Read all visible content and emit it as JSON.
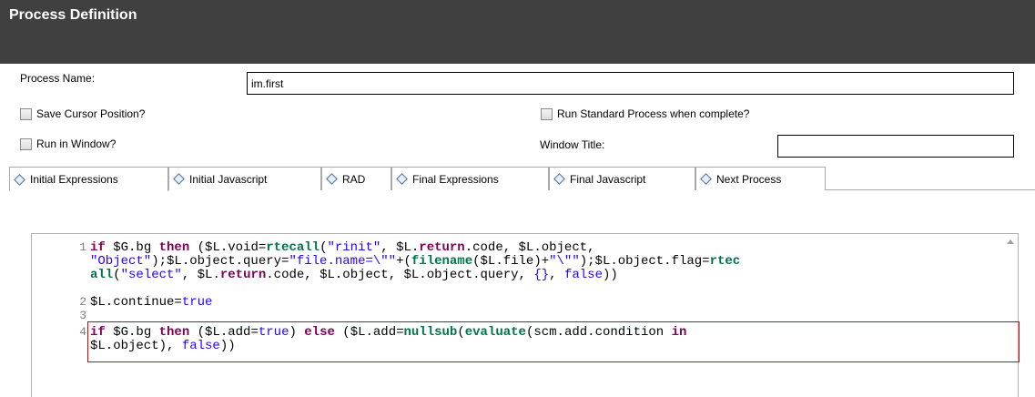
{
  "header": {
    "title": "Process Definition"
  },
  "form": {
    "process_name_label": "Process Name:",
    "process_name_value": "im.first",
    "save_cursor_label": "Save Cursor Position?",
    "run_standard_label": "Run Standard Process when complete?",
    "run_in_window_label": "Run in Window?",
    "window_title_label": "Window Title:",
    "window_title_value": ""
  },
  "tabs": [
    {
      "label": "Initial Expressions",
      "active": true
    },
    {
      "label": "Initial Javascript"
    },
    {
      "label": "RAD"
    },
    {
      "label": "Final Expressions"
    },
    {
      "label": "Final Javascript"
    },
    {
      "label": "Next Process"
    }
  ],
  "editor": {
    "line_numbers": [
      "1",
      "2",
      "3",
      "4"
    ],
    "lines": [
      [
        {
          "t": "if",
          "c": "kw"
        },
        {
          "t": " $G.bg "
        },
        {
          "t": "then",
          "c": "kw"
        },
        {
          "t": " ($L.void="
        },
        {
          "t": "rtecall",
          "c": "fn"
        },
        {
          "t": "("
        },
        {
          "t": "\"rinit\"",
          "c": "str"
        },
        {
          "t": ", $L."
        },
        {
          "t": "return",
          "c": "kw"
        },
        {
          "t": ".code, $L.object,"
        }
      ],
      [
        {
          "t": "\"Object\"",
          "c": "str"
        },
        {
          "t": ");$L.object.query="
        },
        {
          "t": "\"file.name=\\\"\"",
          "c": "str"
        },
        {
          "t": "+("
        },
        {
          "t": "filename",
          "c": "fn"
        },
        {
          "t": "($L.file)+"
        },
        {
          "t": "\"\\\"\"",
          "c": "str"
        },
        {
          "t": ");$L.object.flag="
        },
        {
          "t": "rtec",
          "c": "fn"
        }
      ],
      [
        {
          "t": "all",
          "c": "fn"
        },
        {
          "t": "("
        },
        {
          "t": "\"select\"",
          "c": "str"
        },
        {
          "t": ", $L."
        },
        {
          "t": "return",
          "c": "kw"
        },
        {
          "t": ".code, $L.object, $L.object.query, "
        },
        {
          "t": "{}",
          "c": "str"
        },
        {
          "t": ", "
        },
        {
          "t": "false",
          "c": "bool"
        },
        {
          "t": "))"
        }
      ],
      [
        {
          "t": "$L.continue="
        },
        {
          "t": "true",
          "c": "bool"
        }
      ],
      [],
      [
        {
          "t": "if",
          "c": "kw"
        },
        {
          "t": " $G.bg "
        },
        {
          "t": "then",
          "c": "kw"
        },
        {
          "t": " ($L.add="
        },
        {
          "t": "true",
          "c": "bool"
        },
        {
          "t": ") "
        },
        {
          "t": "else",
          "c": "kw"
        },
        {
          "t": " ($L.add="
        },
        {
          "t": "nullsub",
          "c": "fn"
        },
        {
          "t": "("
        },
        {
          "t": "evaluate",
          "c": "fn"
        },
        {
          "t": "(scm.add.condition "
        },
        {
          "t": "in",
          "c": "kw"
        }
      ],
      [
        {
          "t": "$L.object), "
        },
        {
          "t": "false",
          "c": "bool"
        },
        {
          "t": "))"
        }
      ]
    ]
  }
}
